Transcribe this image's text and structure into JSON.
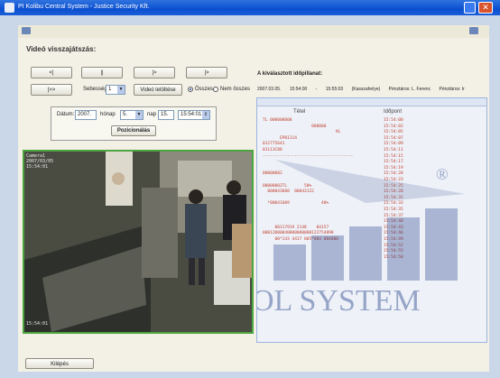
{
  "window": {
    "title": "PI Kolibu Central System - Justice Security Kft."
  },
  "page": {
    "section_title": "Videó visszajátszás:"
  },
  "controls": {
    "row1": [
      "<|",
      "||",
      "|>",
      "|>"
    ],
    "fast_forward": "|>>",
    "speed_label": "Sebesség",
    "speed_value": "1",
    "video_download_button": "Videó letöltése",
    "radio_own": "Összes",
    "radio_other": "Nem összes",
    "date_label": "Dátum:",
    "date_year": "2007.",
    "date_month_label": "hónap",
    "date_month": "5.",
    "date_day_label": "nap",
    "date_day": "15.",
    "date_time": "15:54:01",
    "search_button": "Pozicionálás"
  },
  "info": {
    "heading": "A kiválasztott időpillanat:",
    "date": "2007.03.05.",
    "time_from": "15:54:00",
    "dash": "-",
    "time_to": "15:55:03",
    "register": "(Kasszahelye)",
    "cashier": "Pénztáros: L. Ferenc",
    "extra": "Pénztáros: Ir"
  },
  "receipt": {
    "col_left": "Tétel",
    "col_right": "Időpont",
    "lines": [
      "TL 000000000            ",
      "                    000000       ",
      "                              KL       ",
      "       EP01114        ",
      "012775641        ",
      "01113C88            ",
      "-------------------------------------",
      "                                      ",
      "                                      ",
      "00000082          ",
      "                                      ",
      "00000002TL       50%  ",
      "  000043608  00043122       ",
      "                                      ",
      "  *00041609             40%  ",
      "                                      ",
      "                                      ",
      "                                      ",
      "     00117919 2148    04157    ",
      "00012000040000000000122754898",
      "     00*143 4417 005*004 004800",
      "                                      "
    ],
    "times": [
      "15:54:00",
      "15:54:02",
      "15:54:05",
      "15:54:07",
      "15:54:09",
      "15:54:11",
      "15:54:15",
      "15:54:17",
      "15:54:19",
      "15:54:20",
      "15:54:23",
      "15:54:25",
      "15:54:28",
      "15:54:31",
      "15:54:33",
      "15:54:35",
      "15:54:37",
      "15:54:40",
      "15:54:43",
      "15:54:46",
      "15:54:49",
      "15:54:52",
      "15:54:55",
      "15:54:58"
    ]
  },
  "video": {
    "osd_top": "Camera1\n2007/03/05\n15:54:01",
    "osd_bottom": "15:54:01"
  },
  "watermark": {
    "text": "OL SYSTEM",
    "reg": "®"
  },
  "footer": {
    "close_button": "Kilépés"
  },
  "colors": {
    "accent": "#0a4fd0",
    "receipt_text": "#c2402e",
    "video_border": "#4da53e"
  }
}
